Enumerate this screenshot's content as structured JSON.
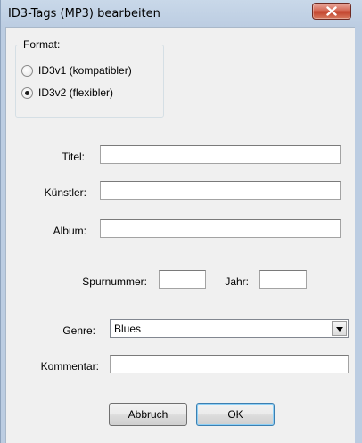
{
  "window": {
    "title": "ID3-Tags (MP3) bearbeiten"
  },
  "format_group": {
    "legend": "Format:",
    "options": [
      {
        "label": "ID3v1 (kompatibler)",
        "checked": false
      },
      {
        "label": "ID3v2 (flexibler)",
        "checked": true
      }
    ]
  },
  "fields": {
    "titel": {
      "label": "Titel:",
      "value": ""
    },
    "kuenstler": {
      "label": "Künstler:",
      "value": ""
    },
    "album": {
      "label": "Album:",
      "value": ""
    },
    "spurnummer": {
      "label": "Spurnummer:",
      "value": ""
    },
    "jahr": {
      "label": "Jahr:",
      "value": ""
    },
    "genre": {
      "label": "Genre:",
      "value": "Blues"
    },
    "kommentar": {
      "label": "Kommentar:",
      "value": ""
    }
  },
  "buttons": {
    "cancel": "Abbruch",
    "ok": "OK"
  },
  "colors": {
    "close_button": "#c2432c",
    "dialog_background": "#f0f0f0",
    "frame": "#bccde2"
  }
}
